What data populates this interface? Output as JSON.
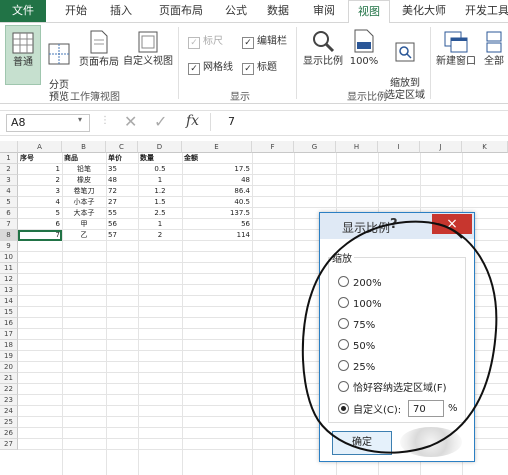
{
  "tabs": [
    "文件",
    "开始",
    "插入",
    "页面布局",
    "公式",
    "数据",
    "审阅",
    "视图",
    "美化大师",
    "开发工具"
  ],
  "ribbon": {
    "workbook_views": {
      "buttons": [
        "普通",
        "分页\n预览",
        "页面布局",
        "自定义视图"
      ],
      "group_label": "工作簿视图"
    },
    "show": {
      "checks": [
        {
          "label": "标尺",
          "checked": true,
          "disabled": true
        },
        {
          "label": "编辑栏",
          "checked": true,
          "disabled": false
        },
        {
          "label": "网格线",
          "checked": true,
          "disabled": false
        },
        {
          "label": "标题",
          "checked": true,
          "disabled": false
        }
      ],
      "group_label": "显示"
    },
    "zoom": {
      "buttons": [
        "显示比例",
        "100%",
        "缩放到\n选定区域"
      ],
      "group_label": "显示比例"
    },
    "window": {
      "buttons": [
        "新建窗口",
        "全部"
      ]
    }
  },
  "formula_bar": {
    "name_box": "A8",
    "fx": "fx",
    "value": "7"
  },
  "sheet": {
    "columns": [
      "A",
      "B",
      "C",
      "D",
      "E",
      "F",
      "G",
      "H",
      "I",
      "J",
      "K"
    ],
    "rows": [
      "1",
      "2",
      "3",
      "4",
      "5",
      "6",
      "7",
      "8",
      "9",
      "10",
      "11",
      "12",
      "13",
      "14",
      "15",
      "16",
      "17",
      "18",
      "19",
      "20",
      "21",
      "22",
      "23",
      "24",
      "25",
      "26",
      "27"
    ],
    "header": [
      "序号",
      "商品",
      "单价",
      "数量",
      "金额"
    ],
    "data": [
      [
        "1",
        "铅笔",
        "35",
        "0.5",
        "17.5"
      ],
      [
        "2",
        "橡皮",
        "48",
        "1",
        "48"
      ],
      [
        "3",
        "卷笔刀",
        "72",
        "1.2",
        "86.4"
      ],
      [
        "4",
        "小本子",
        "27",
        "1.5",
        "40.5"
      ],
      [
        "5",
        "大本子",
        "55",
        "2.5",
        "137.5"
      ],
      [
        "6",
        "甲",
        "56",
        "1",
        "56"
      ],
      [
        "7",
        "乙",
        "57",
        "2",
        "114"
      ]
    ]
  },
  "dialog": {
    "title": "显示比例",
    "help": "?",
    "close": "×",
    "section_label": "缩放",
    "options": [
      "200%",
      "100%",
      "75%",
      "50%",
      "25%",
      "恰好容纳选定区域(F)"
    ],
    "custom_label": "自定义(C):",
    "custom_value": "70",
    "percent_sign": "%",
    "ok": "确定"
  }
}
